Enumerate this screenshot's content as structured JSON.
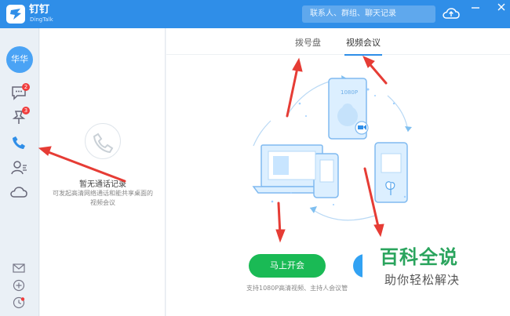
{
  "app": {
    "name": "钉钉",
    "subtitle": "DingTalk",
    "search_placeholder": "联系人、群组、聊天记录"
  },
  "sidebar": {
    "avatar_text": "华华",
    "items": [
      {
        "icon": "chat-icon",
        "badge": "2"
      },
      {
        "icon": "pin-icon",
        "badge": "3"
      },
      {
        "icon": "phone-icon",
        "active": true
      },
      {
        "icon": "contacts-icon"
      },
      {
        "icon": "cloud-icon"
      }
    ],
    "bottom_icons": [
      "mail-icon",
      "add-icon",
      "clock-icon"
    ]
  },
  "call_list": {
    "empty_title": "暂无通话记录",
    "empty_description": "可发起高清网络通话和能共享桌面的视频会议"
  },
  "main": {
    "tabs": [
      {
        "label": "拨号盘",
        "active": false
      },
      {
        "label": "视频会议",
        "active": true
      }
    ],
    "illustration": {
      "phone_label": "1080P"
    },
    "buttons": {
      "start_meeting": "马上开会"
    },
    "support_text": "支持1080P高清视频、主持人会议管"
  },
  "watermark": {
    "title": "百科全说",
    "subtitle": "助你轻松解决"
  },
  "colors": {
    "title_bar": "#2f8ee8",
    "active_blue": "#2f8ee8",
    "green_button": "#1aba55",
    "badge": "#f03c3c",
    "annotation_red": "#e63c35"
  }
}
